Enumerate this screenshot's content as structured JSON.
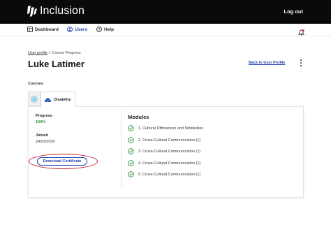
{
  "brand": {
    "name": "Inclusion"
  },
  "header": {
    "logout_label": "Log out"
  },
  "nav": {
    "items": [
      {
        "label": "Dashboard",
        "icon": "dashboard-icon"
      },
      {
        "label": "Users",
        "icon": "users-icon",
        "active": true
      },
      {
        "label": "Help",
        "icon": "help-icon"
      }
    ],
    "notification_icon": "bell-icon"
  },
  "breadcrumb": {
    "parent": "User profile",
    "separator": " > ",
    "current": "Course Progress"
  },
  "page": {
    "title": "Luke Latimer",
    "back_link": "Back to User Profile"
  },
  "courses": {
    "label": "Courses",
    "tabs": [
      {
        "label": "",
        "icon": "globe-icon",
        "active": false
      },
      {
        "label": "Disability",
        "icon": "cloud-icon",
        "active": true
      }
    ]
  },
  "detail": {
    "progress_label": "Progress",
    "progress_value": "100%",
    "joined_label": "Joined",
    "joined_value": "24/02/2020",
    "download_label": "Download Certificate"
  },
  "modules": {
    "title": "Modules",
    "items": [
      "1. Cultural Differences and Similarities",
      "2. Cross-Cultural Communication (1)",
      "3. Cross-Cultural Communication (1)",
      "4. Cross-Cultural Communication (1)",
      "5. Cross-Cultural Communication (1)"
    ]
  },
  "colors": {
    "topbar": "#0a0a0a",
    "accent_blue": "#1f3fb0",
    "success_green": "#2e8b3f",
    "highlight_red": "#c2182b",
    "notification_red": "#d6262f"
  }
}
